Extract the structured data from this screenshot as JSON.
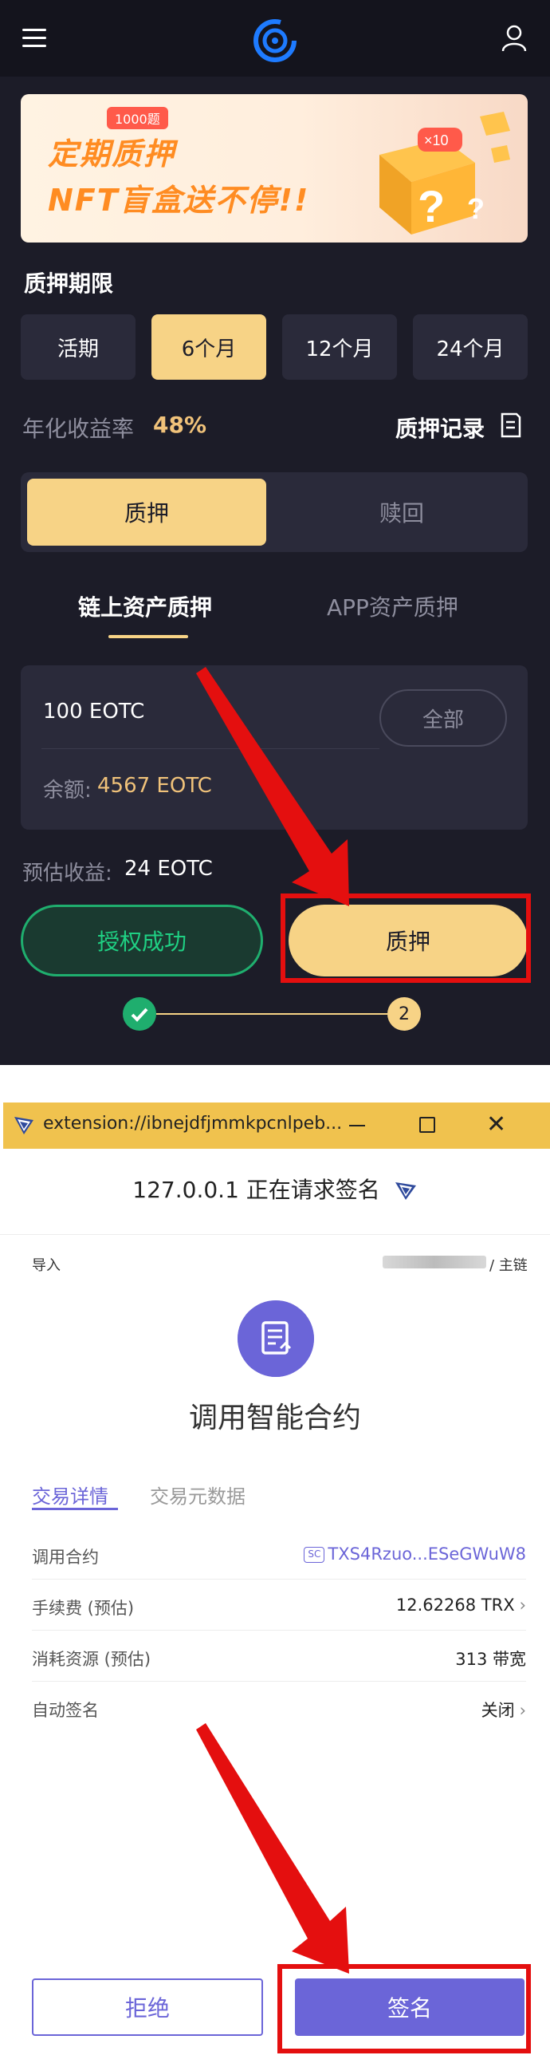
{
  "app": {
    "banner": {
      "badge": "1000题",
      "line1": "定期质押",
      "line2": "NFT盲盒送不停!!",
      "multiplier": "×10"
    },
    "period_title": "质押期限",
    "periods": [
      {
        "label": "活期",
        "active": false
      },
      {
        "label": "6个月",
        "active": true
      },
      {
        "label": "12个月",
        "active": false
      },
      {
        "label": "24个月",
        "active": false
      }
    ],
    "apy_label": "年化收益率",
    "apy_value": "48%",
    "record_link": "质押记录",
    "segment": {
      "stake": "质押",
      "redeem": "赎回"
    },
    "subtabs": {
      "onchain": "链上资产质押",
      "app": "APP资产质押"
    },
    "amount_input": {
      "value": "100 EOTC"
    },
    "max_button": "全部",
    "balance_label": "余额:",
    "balance_value": "4567 EOTC",
    "estimate_label": "预估收益:",
    "estimate_value": "24 EOTC",
    "auth_button": "授权成功",
    "stake_button": "质押",
    "step_two": "2"
  },
  "wallet": {
    "window_title": "extension://ibnejdfjmmkpcnlpeb...",
    "request_title": "127.0.0.1 正在请求签名",
    "import_label": "导入",
    "network_label": "/ 主链",
    "contract_title": "调用智能合约",
    "tabs": {
      "details": "交易详情",
      "metadata": "交易元数据"
    },
    "rows": {
      "contract": {
        "label": "调用合约",
        "badge": "SC",
        "value": "TXS4Rzuo...ESeGWuW8"
      },
      "fee": {
        "label": "手续费 (预估)",
        "value": "12.62268 TRX"
      },
      "resource": {
        "label": "消耗资源 (预估)",
        "value": "313 带宽"
      },
      "auto_sign": {
        "label": "自动签名",
        "value": "关闭"
      }
    },
    "reject_button": "拒绝",
    "sign_button": "签名"
  },
  "colors": {
    "app_bg": "#1c1c28",
    "accent_gold": "#f7d386",
    "success_green": "#1fae6e",
    "wallet_purple": "#6b65d8",
    "annotation_red": "#e40f0f"
  }
}
